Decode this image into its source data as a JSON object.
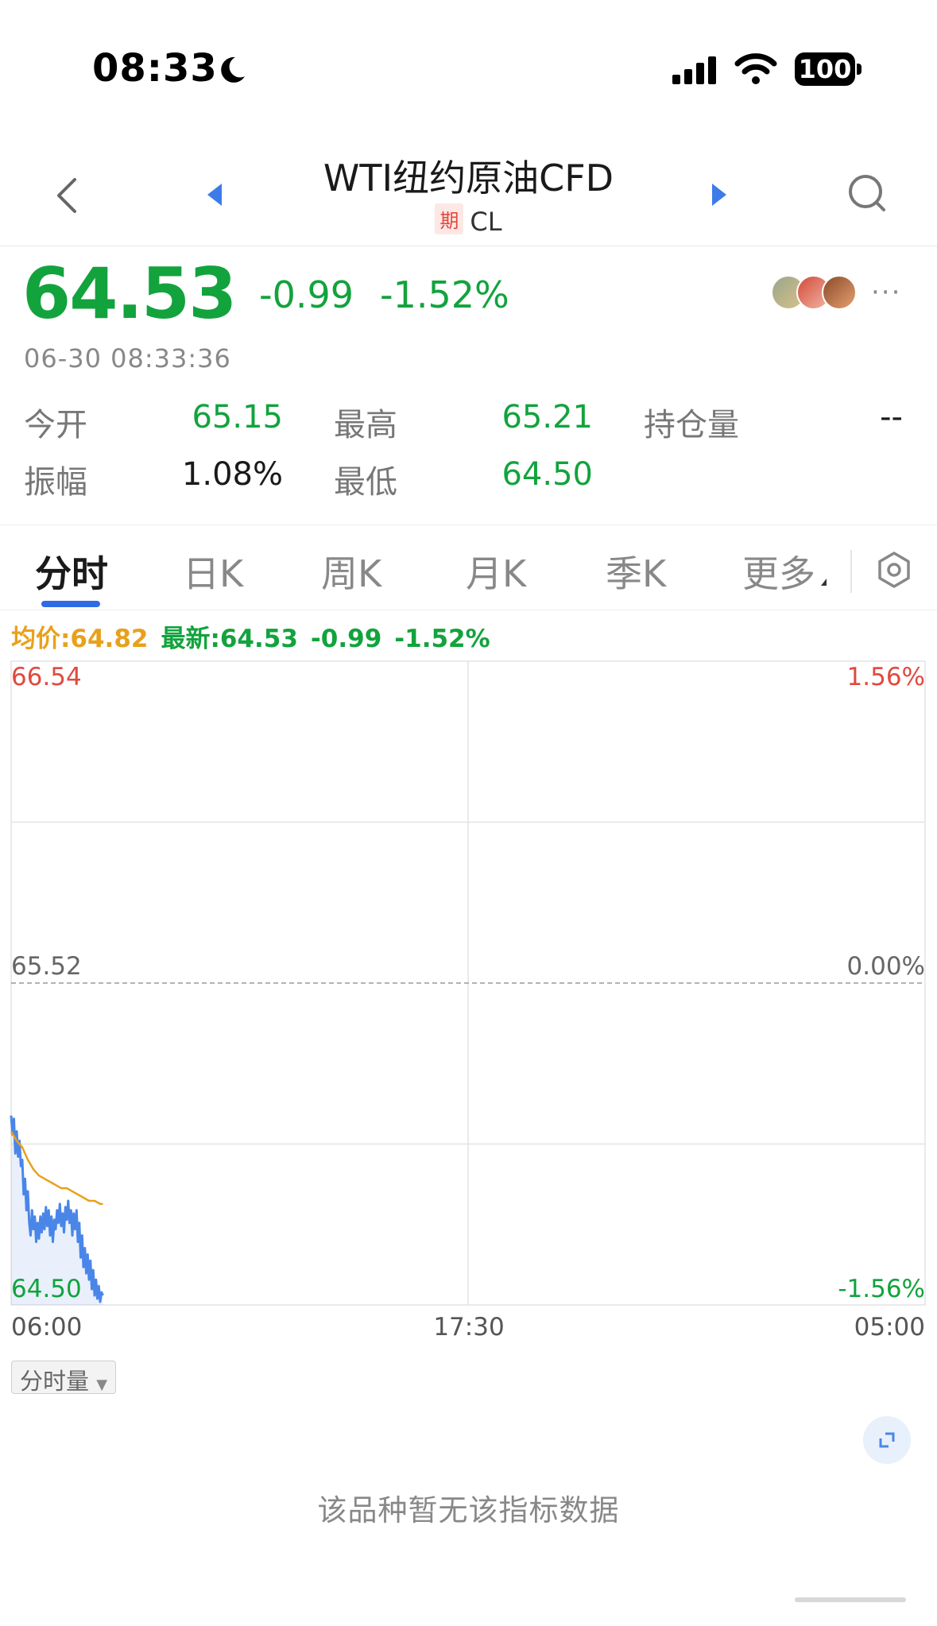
{
  "status_bar": {
    "time": "08:33",
    "battery": "100"
  },
  "nav": {
    "title": "WTI纽约原油CFD",
    "badge": "期",
    "code": "CL"
  },
  "quote": {
    "price": "64.53",
    "change": "-0.99",
    "change_pct": "-1.52%",
    "timestamp": "06-30 08:33:36",
    "more": "···"
  },
  "stats": {
    "open_label": "今开",
    "open": "65.15",
    "high_label": "最高",
    "high": "65.21",
    "oi_label": "持仓量",
    "oi": "--",
    "amp_label": "振幅",
    "amp": "1.08%",
    "low_label": "最低",
    "low": "64.50"
  },
  "tabs": [
    "分时",
    "日K",
    "周K",
    "月K",
    "季K",
    "更多"
  ],
  "legend": {
    "avg": "均价:64.82",
    "latest": "最新:64.53",
    "change": "-0.99",
    "pct": "-1.52%"
  },
  "chart_data": {
    "type": "line",
    "title": "",
    "ylim": [
      64.5,
      66.54
    ],
    "y_ticks_left": [
      "66.54",
      "65.52",
      "64.50"
    ],
    "y_ticks_right": [
      "1.56%",
      "0.00%",
      "-1.56%"
    ],
    "x_ticks": [
      "06:00",
      "17:30",
      "05:00"
    ],
    "baseline": 65.52,
    "series": [
      {
        "name": "最新",
        "color": "#4a86e8",
        "x": [
          0,
          1,
          2,
          3,
          4,
          5,
          6,
          7,
          8,
          9,
          10,
          11,
          12,
          13,
          14,
          15,
          16,
          17,
          18,
          19,
          20,
          21,
          22,
          23,
          24,
          25,
          26,
          27,
          28,
          29,
          30,
          31,
          32,
          33,
          34,
          35,
          36,
          37,
          38,
          39,
          40,
          41,
          42,
          43,
          44,
          45,
          46,
          47,
          48,
          49,
          50,
          51,
          52,
          53,
          54,
          55,
          56,
          57,
          58,
          59,
          60,
          61,
          62,
          63,
          64,
          65,
          66
        ],
        "y": [
          65.1,
          65.04,
          65.09,
          64.98,
          65.05,
          64.97,
          65.02,
          64.94,
          64.96,
          64.85,
          64.9,
          64.8,
          64.86,
          64.76,
          64.72,
          64.8,
          64.74,
          64.78,
          64.7,
          64.76,
          64.71,
          64.78,
          64.73,
          64.79,
          64.74,
          64.81,
          64.75,
          64.8,
          64.72,
          64.78,
          64.7,
          64.77,
          64.74,
          64.8,
          64.76,
          64.82,
          64.75,
          64.79,
          64.73,
          64.81,
          64.77,
          64.83,
          64.76,
          64.8,
          64.72,
          64.79,
          64.74,
          64.8,
          64.7,
          64.76,
          64.65,
          64.72,
          64.62,
          64.68,
          64.6,
          64.66,
          64.58,
          64.64,
          64.55,
          64.61,
          64.53,
          64.58,
          64.52,
          64.56,
          64.51,
          64.54,
          64.53
        ]
      },
      {
        "name": "均价",
        "color": "#e8a11c",
        "x": [
          0,
          4,
          8,
          12,
          16,
          20,
          24,
          28,
          32,
          36,
          40,
          44,
          48,
          52,
          56,
          60,
          64,
          66
        ],
        "y": [
          65.05,
          65.02,
          65.0,
          64.96,
          64.93,
          64.91,
          64.9,
          64.89,
          64.88,
          64.87,
          64.87,
          64.86,
          64.85,
          64.84,
          64.83,
          64.83,
          64.82,
          64.82
        ]
      }
    ],
    "x_total": 1380
  },
  "volume_select": "分时量",
  "no_data": "该品种暂无该指标数据"
}
